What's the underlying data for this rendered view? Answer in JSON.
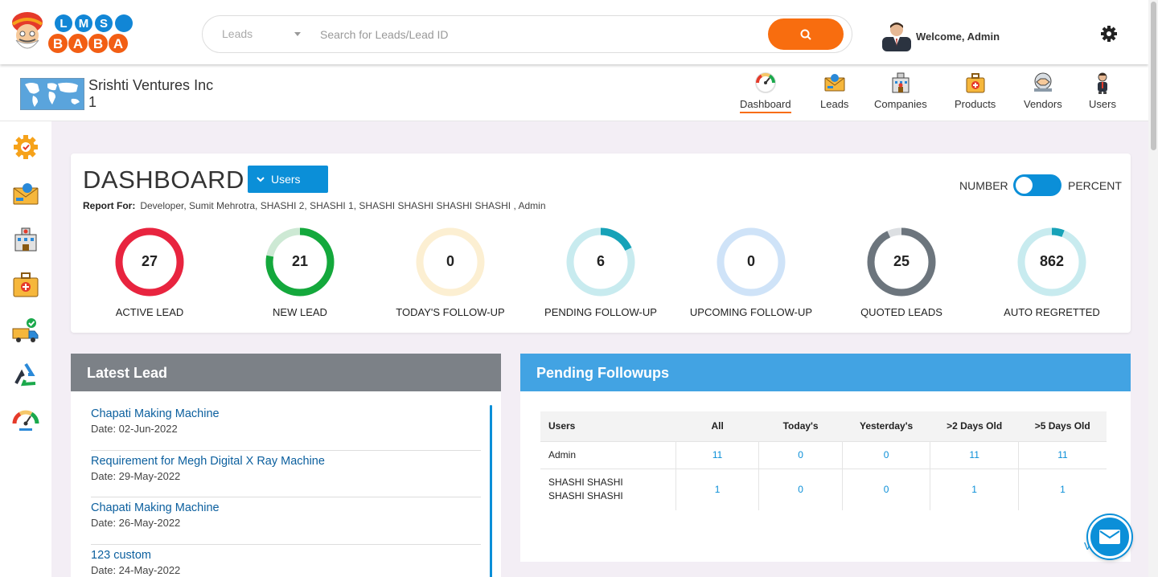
{
  "header": {
    "logo": {
      "text_top": "LMS",
      "text_bottom": "BABA"
    },
    "search": {
      "category": "Leads",
      "placeholder": "Search for Leads/Lead ID"
    },
    "welcome": "Welcome, Admin"
  },
  "company": {
    "name": "Srishti Ventures Inc 1"
  },
  "nav": [
    {
      "label": "Dashboard",
      "icon": "speedometer-icon",
      "active": true
    },
    {
      "label": "Leads",
      "icon": "leads-envelope-icon",
      "active": false
    },
    {
      "label": "Companies",
      "icon": "building-icon",
      "active": false
    },
    {
      "label": "Products",
      "icon": "medical-bag-icon",
      "active": false
    },
    {
      "label": "Vendors",
      "icon": "handshake-icon",
      "active": false
    },
    {
      "label": "Users",
      "icon": "user-icon",
      "active": false
    }
  ],
  "sidebar_icons": [
    "settings-gear-icon",
    "leads-envelope-icon",
    "building-icon",
    "medical-bag-icon",
    "vendor-truck-icon",
    "recycle-icon",
    "speedometer-icon"
  ],
  "dashboard": {
    "title": "DASHBOARD",
    "users_button": "Users",
    "report_label": "Report For:",
    "report_value": "Developer, Sumit Mehrotra, SHASHI 2, SHASHI 1, SHASHI SHASHI SHASHI SHASHI , Admin",
    "toggle": {
      "left": "NUMBER",
      "right": "PERCENT",
      "state": "on"
    },
    "stats": [
      {
        "value": "27",
        "label": "ACTIVE LEAD",
        "color": "#e8243f",
        "track": "#fad3d9",
        "fraction": 1.0
      },
      {
        "value": "21",
        "label": "NEW LEAD",
        "color": "#14a83c",
        "track": "#cde9d4",
        "fraction": 0.78
      },
      {
        "value": "0",
        "label": "TODAY'S FOLLOW-UP",
        "color": "#f6c76a",
        "track": "#fcefd2",
        "fraction": 0
      },
      {
        "value": "6",
        "label": "PENDING FOLLOW-UP",
        "color": "#17a2b8",
        "track": "#c8ebef",
        "fraction": 0.18
      },
      {
        "value": "0",
        "label": "UPCOMING FOLLOW-UP",
        "color": "#90bfee",
        "track": "#cfe3f8",
        "fraction": 0
      },
      {
        "value": "25",
        "label": "QUOTED LEADS",
        "color": "#6c757d",
        "track": "#dcdfe2",
        "fraction": 0.93
      },
      {
        "value": "862",
        "label": "AUTO REGRETTED",
        "color": "#17a2b8",
        "track": "#c8ebef",
        "fraction": 0.06
      }
    ]
  },
  "latest_lead": {
    "title": "Latest Lead",
    "items": [
      {
        "title": "Chapati Making Machine",
        "date": "Date: 02-Jun-2022"
      },
      {
        "title": "Requirement for Megh Digital X Ray Machine",
        "date": "Date: 29-May-2022"
      },
      {
        "title": "Chapati Making Machine",
        "date": "Date: 26-May-2022"
      },
      {
        "title": "123 custom",
        "date": "Date: 24-May-2022"
      }
    ]
  },
  "pending_followups": {
    "title": "Pending Followups",
    "columns": [
      "Users",
      "All",
      "Today's",
      "Yesterday's",
      ">2 Days Old",
      ">5 Days Old"
    ],
    "rows": [
      [
        "Admin",
        "11",
        "0",
        "0",
        "11",
        "11"
      ],
      [
        "SHASHI SHASHI SHASHI SHASHI",
        "1",
        "0",
        "0",
        "1",
        "1"
      ]
    ],
    "view_all": "Vi"
  },
  "colors": {
    "accent_orange": "#f86d0f",
    "primary_blue": "#0b8fd8",
    "latest_header": "#7c8187",
    "pending_header": "#42a3e3",
    "page_bg": "#f3eef5"
  }
}
